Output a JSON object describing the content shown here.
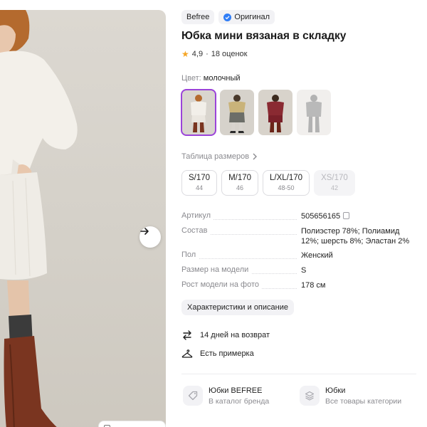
{
  "product": {
    "brand": "Befree",
    "original_badge": "Оригинал",
    "title": "Юбка мини вязаная в складку",
    "rating": "4,9",
    "reviews": "18 оценок",
    "color_label": "Цвет:",
    "color_value": "молочный"
  },
  "swatches": [
    {
      "name": "молочный",
      "selected": true,
      "accent": "#efece6"
    },
    {
      "name": "серый",
      "selected": false,
      "accent": "#6c6e68"
    },
    {
      "name": "бордовый",
      "selected": false,
      "accent": "#8a2a32"
    },
    {
      "name": "недоступно",
      "selected": false,
      "accent": "#4a4a4a"
    }
  ],
  "size_table_link": "Таблица размеров",
  "sizes": [
    {
      "label": "S/170",
      "sub": "44",
      "available": true
    },
    {
      "label": "M/170",
      "sub": "46",
      "available": true
    },
    {
      "label": "L/XL/170",
      "sub": "48-50",
      "available": true
    },
    {
      "label": "XS/170",
      "sub": "42",
      "available": false
    }
  ],
  "specs": [
    {
      "key": "Артикул",
      "value": "505656165"
    },
    {
      "key": "Состав",
      "value": "Полиэстер 78%; Полиамид 12%; шерсть 8%; Эластан 2%"
    },
    {
      "key": "Пол",
      "value": "Женский"
    },
    {
      "key": "Размер на модели",
      "value": "S"
    },
    {
      "key": "Рост модели на фото",
      "value": "178 см"
    }
  ],
  "characteristics_button": "Характеристики и описание",
  "features": {
    "return": "14 дней на возврат",
    "fitting": "Есть примерка"
  },
  "links": {
    "brand_title": "Юбки BEFREE",
    "brand_sub": "В каталог бренда",
    "category_title": "Юбки",
    "category_sub": "Все товары категории"
  },
  "colors": {
    "accent_purple": "#9b43d9",
    "verified_blue": "#2f7df6",
    "star": "#f5a524"
  }
}
